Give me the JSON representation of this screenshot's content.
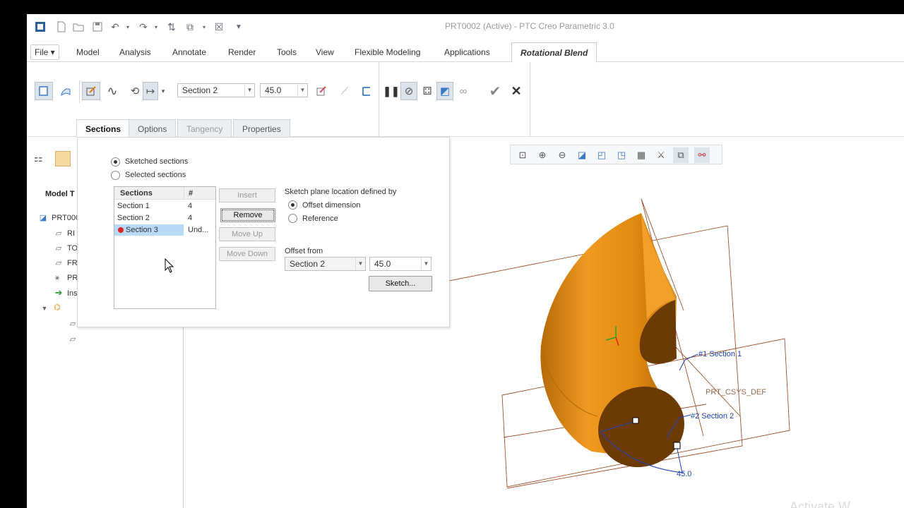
{
  "window": {
    "title": "PRT0002 (Active) - PTC Creo Parametric 3.0"
  },
  "tabs": [
    {
      "label": "File ▾"
    },
    {
      "label": "Model"
    },
    {
      "label": "Analysis"
    },
    {
      "label": "Annotate"
    },
    {
      "label": "Render"
    },
    {
      "label": "Tools"
    },
    {
      "label": "View"
    },
    {
      "label": "Flexible Modeling"
    },
    {
      "label": "Applications"
    },
    {
      "label": "Rotational Blend"
    }
  ],
  "ribbon": {
    "section_combo": "Section 2",
    "angle_combo": "45.0"
  },
  "dashboard_tabs": [
    {
      "label": "Sections"
    },
    {
      "label": "Options"
    },
    {
      "label": "Tangency"
    },
    {
      "label": "Properties"
    }
  ],
  "left_panel": {
    "header": "Model T",
    "root": "PRT000",
    "items": [
      "RI",
      "TO",
      "FR",
      "PR",
      "Ins"
    ]
  },
  "sections_panel": {
    "radio_sketched": "Sketched sections",
    "radio_selected": "Selected sections",
    "table_headers": [
      "Sections",
      "#"
    ],
    "rows": [
      {
        "name": "Section 1",
        "count": "4"
      },
      {
        "name": "Section 2",
        "count": "4"
      },
      {
        "name": "Section 3",
        "count": "Und..."
      }
    ],
    "buttons": {
      "insert": "Insert",
      "remove": "Remove",
      "move_up": "Move Up",
      "move_down": "Move Down"
    },
    "location_label": "Sketch plane location defined by",
    "radio_offset": "Offset dimension",
    "radio_reference": "Reference",
    "offset_from_label": "Offset from",
    "offset_from_value": "Section 2",
    "offset_value": "45.0",
    "sketch_button": "Sketch..."
  },
  "graphics": {
    "label_section1": "#1 Section 1",
    "label_section2": "#2 Section 2",
    "label_csys": "PRT_CSYS_DEF",
    "label_angle": "45.0",
    "body_color": "#e08a10"
  },
  "watermark": "Activate W"
}
